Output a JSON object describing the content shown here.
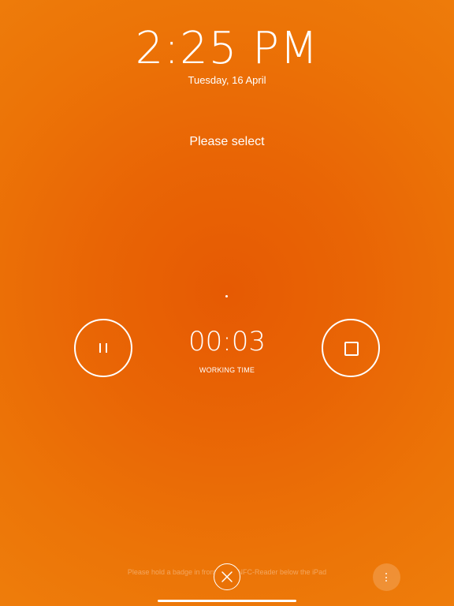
{
  "header": {
    "time": "2:25 PM",
    "date": "Tuesday, 16 April"
  },
  "status": {
    "prompt": "Please select"
  },
  "timer": {
    "value": "00:03",
    "label": "WORKING TIME"
  },
  "controls": {
    "pause_icon": "pause-icon",
    "stop_icon": "stop-icon",
    "close_icon": "close-icon",
    "more_icon": "more-vertical-icon"
  },
  "footer": {
    "hint": "Please hold a badge in front of the NFC-Reader below the iPad"
  },
  "colors": {
    "background_center": "#e65a03",
    "background_edge": "#ee7d0b",
    "foreground": "#ffffff"
  }
}
